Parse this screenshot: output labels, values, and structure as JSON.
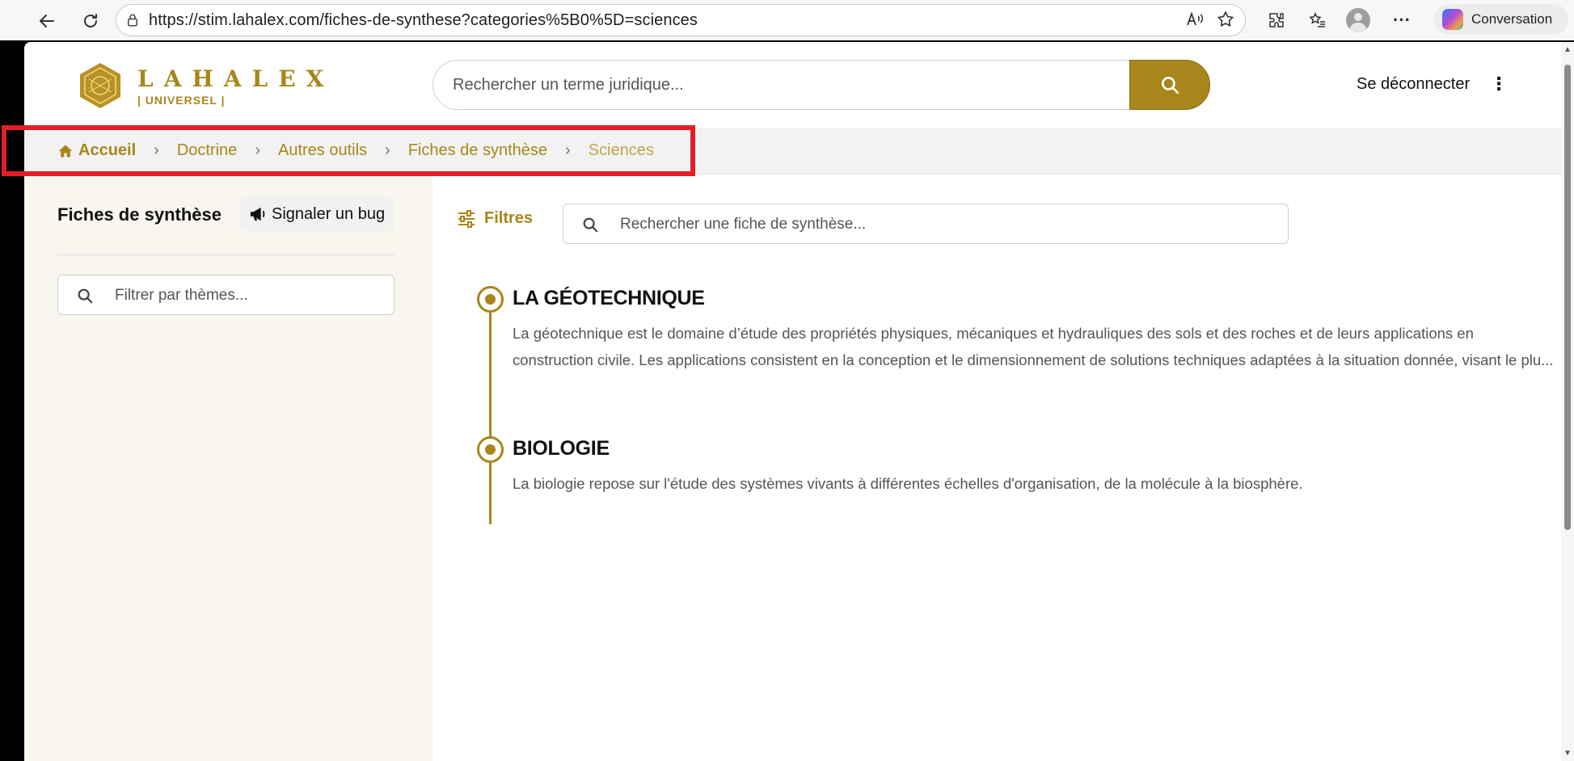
{
  "browser": {
    "url": "https://stim.lahalex.com/fiches-de-synthese?categories%5B0%5D=sciences",
    "conversation_label": "Conversation"
  },
  "header": {
    "logo_line1": "LAHALEX",
    "logo_line2": "| UNIVERSEL |",
    "search_placeholder": "Rechercher un terme juridique...",
    "logout_label": "Se déconnecter"
  },
  "breadcrumb": {
    "items": [
      {
        "label": "Accueil"
      },
      {
        "label": "Doctrine"
      },
      {
        "label": "Autres outils"
      },
      {
        "label": "Fiches de synthèse"
      },
      {
        "label": "Sciences"
      }
    ]
  },
  "sidebar": {
    "title": "Fiches de synthèse",
    "bug_button": "Signaler un bug",
    "filter_placeholder": "Filtrer par thèmes..."
  },
  "main": {
    "filters_label": "Filtres",
    "search_placeholder": "Rechercher une fiche de synthèse...",
    "entries": [
      {
        "title": "LA GÉOTECHNIQUE",
        "description": "La géotechnique est le domaine d’étude des propriétés physiques, mécaniques et hydrauliques des sols et des roches et de leurs applications en construction civile. Les applications consistent en la conception et le dimensionnement de solutions techniques adaptées à la situation donnée, visant le plu..."
      },
      {
        "title": "BIOLOGIE",
        "description": "La biologie repose sur l'étude des systèmes vivants à différentes échelles d'organisation, de la molécule à la biosphère."
      }
    ]
  },
  "colors": {
    "accent_gold": "#a8861b",
    "highlight_red": "#e21e26",
    "sidebar_bg": "#f9f5ef"
  }
}
